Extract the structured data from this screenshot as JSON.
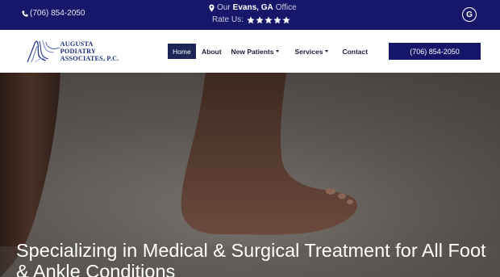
{
  "topbar": {
    "phone": "(706) 854-2050",
    "office_prefix": "Our",
    "office_city": "Evans, GA",
    "office_suffix": "Office",
    "rate_label": "Rate Us:",
    "rating_stars": 5,
    "google_label": "G"
  },
  "logo": {
    "line1": "AUGUSTA PODIATRY",
    "line2": "ASSOCIATES, P.C."
  },
  "nav": {
    "items": [
      {
        "label": "Home",
        "active": true,
        "dropdown": false
      },
      {
        "label": "About",
        "active": false,
        "dropdown": false
      },
      {
        "label": "New Patients",
        "active": false,
        "dropdown": true
      },
      {
        "label": "Services",
        "active": false,
        "dropdown": true
      },
      {
        "label": "Contact",
        "active": false,
        "dropdown": false
      }
    ],
    "phone_button": "(706) 854-2050"
  },
  "hero": {
    "heading": "Specializing in Medical & Surgical Treatment for All Foot & Ankle Conditions"
  },
  "colors": {
    "topbar_bg": "#17176a",
    "nav_active_bg": "#1b2556",
    "phone_button_bg": "#15156a",
    "logo_text": "#1d2c7a"
  }
}
